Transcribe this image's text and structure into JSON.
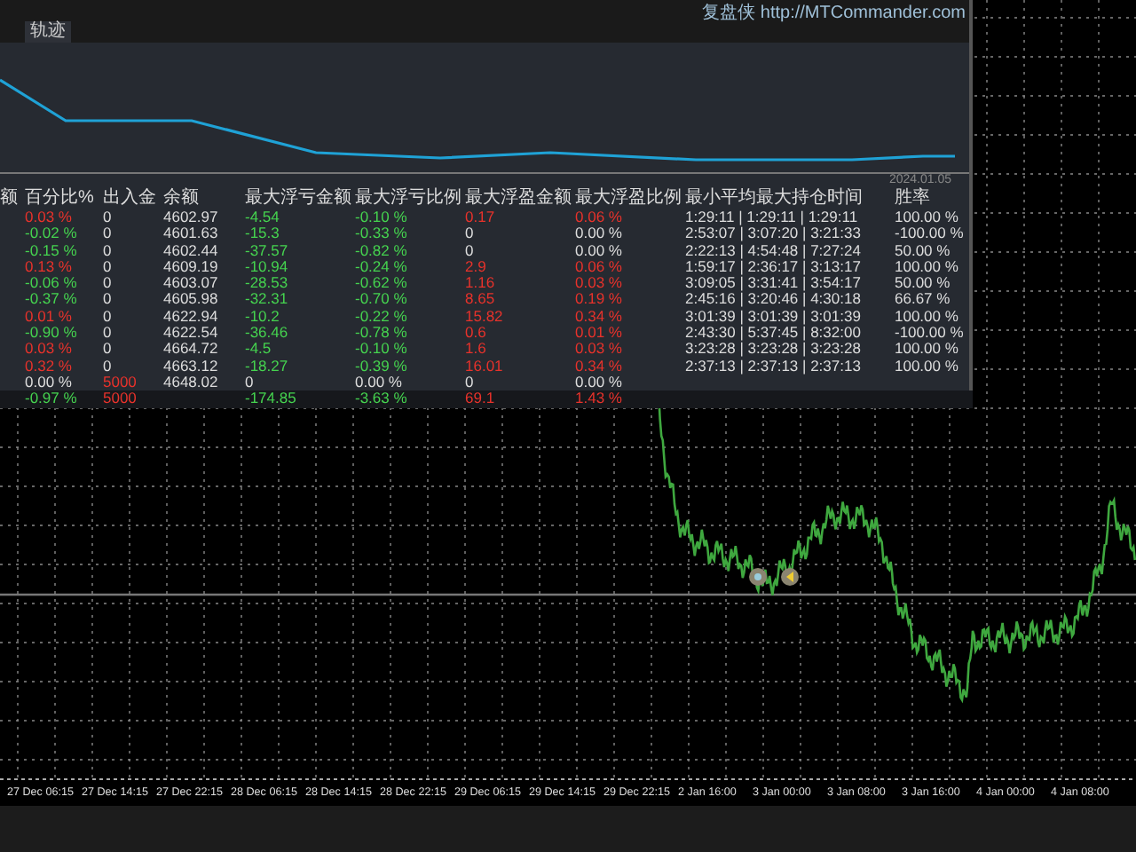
{
  "panel": {
    "tab": {
      "label": "轨迹",
      "selected": true
    },
    "brand": "复盘侠",
    "url": "http://MTCommander.com",
    "equity_chart": {
      "date_label": "2024.01.05"
    },
    "table": {
      "columns": [
        "额",
        "百分比%",
        "出入金",
        "余额",
        "最大浮亏金额",
        "最大浮亏比例",
        "最大浮盈金额",
        "最大浮盈比例",
        "最小平均最大持仓时间",
        "胜率"
      ],
      "rows": [
        {
          "cells": [
            {
              "text": ""
            },
            {
              "text": "0.03 %",
              "color": "#e8322b"
            },
            {
              "text": "0"
            },
            {
              "text": "4602.97"
            },
            {
              "text": "-4.54",
              "color": "#45d34f"
            },
            {
              "text": "-0.10 %",
              "color": "#45d34f"
            },
            {
              "text": "0.17",
              "color": "#e8322b"
            },
            {
              "text": "0.06 %",
              "color": "#e8322b"
            },
            {
              "text": "1:29:11 | 1:29:11 | 1:29:11"
            },
            {
              "text": "100.00 %"
            }
          ]
        },
        {
          "cells": [
            {
              "text": ""
            },
            {
              "text": "-0.02 %",
              "color": "#45d34f"
            },
            {
              "text": "0"
            },
            {
              "text": "4601.63"
            },
            {
              "text": "-15.3",
              "color": "#45d34f"
            },
            {
              "text": "-0.33 %",
              "color": "#45d34f"
            },
            {
              "text": "0"
            },
            {
              "text": "0.00 %"
            },
            {
              "text": "2:53:07 | 3:07:20 | 3:21:33"
            },
            {
              "text": "-100.00 %"
            }
          ]
        },
        {
          "cells": [
            {
              "text": ""
            },
            {
              "text": "-0.15 %",
              "color": "#45d34f"
            },
            {
              "text": "0"
            },
            {
              "text": "4602.44"
            },
            {
              "text": "-37.57",
              "color": "#45d34f"
            },
            {
              "text": "-0.82 %",
              "color": "#45d34f"
            },
            {
              "text": "0"
            },
            {
              "text": "0.00 %"
            },
            {
              "text": "2:22:13 | 4:54:48 | 7:27:24"
            },
            {
              "text": "50.00 %"
            }
          ]
        },
        {
          "cells": [
            {
              "text": ""
            },
            {
              "text": "0.13 %",
              "color": "#e8322b"
            },
            {
              "text": "0"
            },
            {
              "text": "4609.19"
            },
            {
              "text": "-10.94",
              "color": "#45d34f"
            },
            {
              "text": "-0.24 %",
              "color": "#45d34f"
            },
            {
              "text": "2.9",
              "color": "#e8322b"
            },
            {
              "text": "0.06 %",
              "color": "#e8322b"
            },
            {
              "text": "1:59:17 | 2:36:17 | 3:13:17"
            },
            {
              "text": "100.00 %"
            }
          ]
        },
        {
          "cells": [
            {
              "text": ""
            },
            {
              "text": "-0.06 %",
              "color": "#45d34f"
            },
            {
              "text": "0"
            },
            {
              "text": "4603.07"
            },
            {
              "text": "-28.53",
              "color": "#45d34f"
            },
            {
              "text": "-0.62 %",
              "color": "#45d34f"
            },
            {
              "text": "1.16",
              "color": "#e8322b"
            },
            {
              "text": "0.03 %",
              "color": "#e8322b"
            },
            {
              "text": "3:09:05 | 3:31:41 | 3:54:17"
            },
            {
              "text": "50.00 %"
            }
          ]
        },
        {
          "cells": [
            {
              "text": ""
            },
            {
              "text": "-0.37 %",
              "color": "#45d34f"
            },
            {
              "text": "0"
            },
            {
              "text": "4605.98"
            },
            {
              "text": "-32.31",
              "color": "#45d34f"
            },
            {
              "text": "-0.70 %",
              "color": "#45d34f"
            },
            {
              "text": "8.65",
              "color": "#e8322b"
            },
            {
              "text": "0.19 %",
              "color": "#e8322b"
            },
            {
              "text": "2:45:16 | 3:20:46 | 4:30:18"
            },
            {
              "text": "66.67 %"
            }
          ]
        },
        {
          "cells": [
            {
              "text": ""
            },
            {
              "text": "0.01 %",
              "color": "#e8322b"
            },
            {
              "text": "0"
            },
            {
              "text": "4622.94"
            },
            {
              "text": "-10.2",
              "color": "#45d34f"
            },
            {
              "text": "-0.22 %",
              "color": "#45d34f"
            },
            {
              "text": "15.82",
              "color": "#e8322b"
            },
            {
              "text": "0.34 %",
              "color": "#e8322b"
            },
            {
              "text": "3:01:39 | 3:01:39 | 3:01:39"
            },
            {
              "text": "100.00 %"
            }
          ]
        },
        {
          "cells": [
            {
              "text": ""
            },
            {
              "text": "-0.90 %",
              "color": "#45d34f"
            },
            {
              "text": "0"
            },
            {
              "text": "4622.54"
            },
            {
              "text": "-36.46",
              "color": "#45d34f"
            },
            {
              "text": "-0.78 %",
              "color": "#45d34f"
            },
            {
              "text": "0.6",
              "color": "#e8322b"
            },
            {
              "text": "0.01 %",
              "color": "#e8322b"
            },
            {
              "text": "2:43:30 | 5:37:45 | 8:32:00"
            },
            {
              "text": "-100.00 %"
            }
          ]
        },
        {
          "cells": [
            {
              "text": ""
            },
            {
              "text": "0.03 %",
              "color": "#e8322b"
            },
            {
              "text": "0"
            },
            {
              "text": "4664.72"
            },
            {
              "text": "-4.5",
              "color": "#45d34f"
            },
            {
              "text": "-0.10 %",
              "color": "#45d34f"
            },
            {
              "text": "1.6",
              "color": "#e8322b"
            },
            {
              "text": "0.03 %",
              "color": "#e8322b"
            },
            {
              "text": "3:23:28 | 3:23:28 | 3:23:28"
            },
            {
              "text": "100.00 %"
            }
          ]
        },
        {
          "cells": [
            {
              "text": ""
            },
            {
              "text": "0.32 %",
              "color": "#e8322b"
            },
            {
              "text": "0"
            },
            {
              "text": "4663.12"
            },
            {
              "text": "-18.27",
              "color": "#45d34f"
            },
            {
              "text": "-0.39 %",
              "color": "#45d34f"
            },
            {
              "text": "16.01",
              "color": "#e8322b"
            },
            {
              "text": "0.34 %",
              "color": "#e8322b"
            },
            {
              "text": "2:37:13 | 2:37:13 | 2:37:13"
            },
            {
              "text": "100.00 %"
            }
          ]
        },
        {
          "cells": [
            {
              "text": ""
            },
            {
              "text": "0.00 %"
            },
            {
              "text": "5000",
              "color": "#e8322b"
            },
            {
              "text": "4648.02"
            },
            {
              "text": "0"
            },
            {
              "text": "0.00 %"
            },
            {
              "text": "0"
            },
            {
              "text": "0.00 %"
            }
          ]
        }
      ],
      "total_row": {
        "cells": [
          {
            "text": ""
          },
          {
            "text": "-0.97 %",
            "color": "#45d34f"
          },
          {
            "text": "5000",
            "color": "#e8322b"
          },
          {
            "text": ""
          },
          {
            "text": "-174.85",
            "color": "#45d34f"
          },
          {
            "text": "-3.63 %",
            "color": "#45d34f"
          },
          {
            "text": "69.1",
            "color": "#e8322b"
          },
          {
            "text": "1.43 %",
            "color": "#e8322b"
          }
        ]
      }
    }
  },
  "chart": {
    "time_labels": [
      "27 Dec 06:15",
      "27 Dec 14:15",
      "27 Dec 22:15",
      "28 Dec 06:15",
      "28 Dec 14:15",
      "28 Dec 22:15",
      "29 Dec 06:15",
      "29 Dec 14:15",
      "29 Dec 22:15",
      "2 Jan 16:00",
      "3 Jan 00:00",
      "3 Jan 08:00",
      "3 Jan 16:00",
      "4 Jan 00:00",
      "4 Jan 08:00"
    ]
  }
}
